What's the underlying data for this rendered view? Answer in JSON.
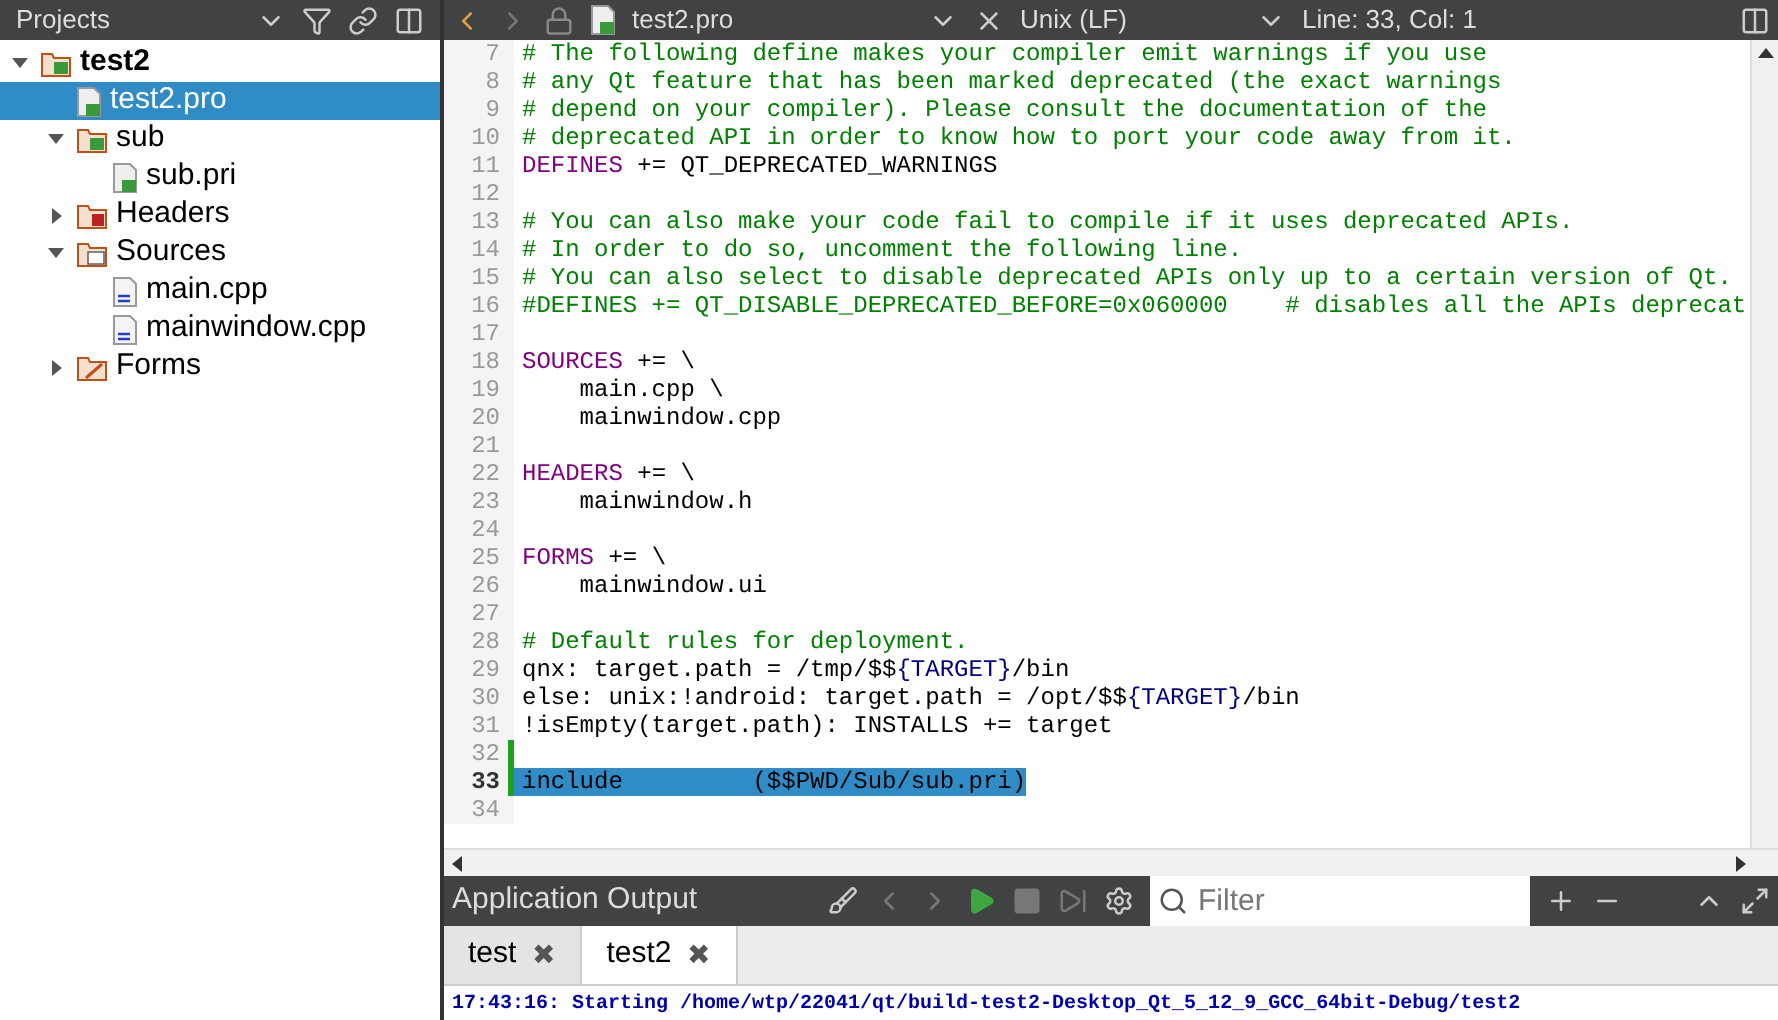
{
  "projects_bar": {
    "title": "Projects"
  },
  "tree": [
    {
      "label": "test2",
      "kind": "project",
      "expanded": true,
      "selected": false,
      "children": [
        {
          "label": "test2.pro",
          "kind": "pro",
          "selected": true
        },
        {
          "label": "sub",
          "kind": "project",
          "expanded": true,
          "selected": false,
          "children": [
            {
              "label": "sub.pri",
              "kind": "pro",
              "selected": false
            }
          ]
        },
        {
          "label": "Headers",
          "kind": "headers",
          "expanded": false,
          "selected": false
        },
        {
          "label": "Sources",
          "kind": "sources",
          "expanded": true,
          "selected": false,
          "children": [
            {
              "label": "main.cpp",
              "kind": "cpp",
              "selected": false
            },
            {
              "label": "mainwindow.cpp",
              "kind": "cpp",
              "selected": false
            }
          ]
        },
        {
          "label": "Forms",
          "kind": "forms",
          "expanded": false,
          "selected": false
        }
      ]
    }
  ],
  "editor_bar": {
    "file": "test2.pro",
    "line_ending": "Unix (LF)",
    "position": "Line: 33, Col: 1"
  },
  "code": [
    {
      "n": "7",
      "modified": false,
      "selected": false,
      "tokens": [
        {
          "t": "# The following define makes your compiler emit warnings if you use",
          "kind": "comment"
        }
      ]
    },
    {
      "n": "8",
      "modified": false,
      "selected": false,
      "tokens": [
        {
          "t": "# any Qt feature that has been marked deprecated (the exact warnings",
          "kind": "comment"
        }
      ]
    },
    {
      "n": "9",
      "modified": false,
      "selected": false,
      "tokens": [
        {
          "t": "# depend on your compiler). Please consult the documentation of the",
          "kind": "comment"
        }
      ]
    },
    {
      "n": "10",
      "modified": false,
      "selected": false,
      "tokens": [
        {
          "t": "# deprecated API in order to know how to port your code away from it.",
          "kind": "comment"
        }
      ]
    },
    {
      "n": "11",
      "modified": false,
      "selected": false,
      "tokens": [
        {
          "t": "DEFINES",
          "kind": "keyword"
        },
        {
          "t": " += QT_DEPRECATED_WARNINGS",
          "kind": "plain"
        }
      ]
    },
    {
      "n": "12",
      "modified": false,
      "selected": false
    },
    {
      "n": "13",
      "modified": false,
      "selected": false,
      "tokens": [
        {
          "t": "# You can also make your code fail to compile if it uses deprecated APIs.",
          "kind": "comment"
        }
      ]
    },
    {
      "n": "14",
      "modified": false,
      "selected": false,
      "tokens": [
        {
          "t": "# In order to do so, uncomment the following line.",
          "kind": "comment"
        }
      ]
    },
    {
      "n": "15",
      "modified": false,
      "selected": false,
      "tokens": [
        {
          "t": "# You can also select to disable deprecated APIs only up to a certain version of Qt.",
          "kind": "comment"
        }
      ]
    },
    {
      "n": "16",
      "modified": false,
      "selected": false,
      "tokens": [
        {
          "t": "#DEFINES += QT_DISABLE_DEPRECATED_BEFORE=0x060000    # disables all the APIs deprecat",
          "kind": "comment"
        }
      ]
    },
    {
      "n": "17",
      "modified": false,
      "selected": false
    },
    {
      "n": "18",
      "modified": false,
      "selected": false,
      "tokens": [
        {
          "t": "SOURCES",
          "kind": "keyword"
        },
        {
          "t": " += \\",
          "kind": "plain"
        }
      ]
    },
    {
      "n": "19",
      "modified": false,
      "selected": false,
      "tokens": [
        {
          "t": "    main.cpp \\",
          "kind": "plain"
        }
      ]
    },
    {
      "n": "20",
      "modified": false,
      "selected": false,
      "tokens": [
        {
          "t": "    mainwindow.cpp",
          "kind": "plain"
        }
      ]
    },
    {
      "n": "21",
      "modified": false,
      "selected": false
    },
    {
      "n": "22",
      "modified": false,
      "selected": false,
      "tokens": [
        {
          "t": "HEADERS",
          "kind": "keyword"
        },
        {
          "t": " += \\",
          "kind": "plain"
        }
      ]
    },
    {
      "n": "23",
      "modified": false,
      "selected": false,
      "tokens": [
        {
          "t": "    mainwindow.h",
          "kind": "plain"
        }
      ]
    },
    {
      "n": "24",
      "modified": false,
      "selected": false
    },
    {
      "n": "25",
      "modified": false,
      "selected": false,
      "tokens": [
        {
          "t": "FORMS",
          "kind": "keyword"
        },
        {
          "t": " += \\",
          "kind": "plain"
        }
      ]
    },
    {
      "n": "26",
      "modified": false,
      "selected": false,
      "tokens": [
        {
          "t": "    mainwindow.ui",
          "kind": "plain"
        }
      ]
    },
    {
      "n": "27",
      "modified": false,
      "selected": false
    },
    {
      "n": "28",
      "modified": false,
      "selected": false,
      "tokens": [
        {
          "t": "# Default rules for deployment.",
          "kind": "comment"
        }
      ]
    },
    {
      "n": "29",
      "modified": false,
      "selected": false,
      "tokens": [
        {
          "t": "qnx: target.path = /tmp/$$",
          "kind": "plain"
        },
        {
          "t": "{TARGET}",
          "kind": "variable"
        },
        {
          "t": "/bin",
          "kind": "plain"
        }
      ]
    },
    {
      "n": "30",
      "modified": false,
      "selected": false,
      "tokens": [
        {
          "t": "else: unix:!android: target.path = /opt/$$",
          "kind": "plain"
        },
        {
          "t": "{TARGET}",
          "kind": "variable"
        },
        {
          "t": "/bin",
          "kind": "plain"
        }
      ]
    },
    {
      "n": "31",
      "modified": false,
      "selected": false,
      "tokens": [
        {
          "t": "!isEmpty(target.path): INSTALLS += target",
          "kind": "plain"
        }
      ]
    },
    {
      "n": "32",
      "modified": true,
      "selected": false
    },
    {
      "n": "33",
      "modified": true,
      "selected": true,
      "tokens": [
        {
          "t": "include         ($$PWD/Sub/sub.pri)",
          "kind": "plain"
        }
      ]
    },
    {
      "n": "34",
      "modified": false,
      "selected": false
    }
  ],
  "output_bar": {
    "title": "Application Output",
    "filter_placeholder": "Filter"
  },
  "output_tabs": [
    {
      "label": "test",
      "selected": false,
      "close": "✖"
    },
    {
      "label": "test2",
      "selected": true,
      "close": "✖"
    }
  ],
  "output_text": "17:43:16: Starting /home/wtp/22041/qt/build-test2-Desktop_Qt_5_12_9_GCC_64bit-Debug/test2"
}
